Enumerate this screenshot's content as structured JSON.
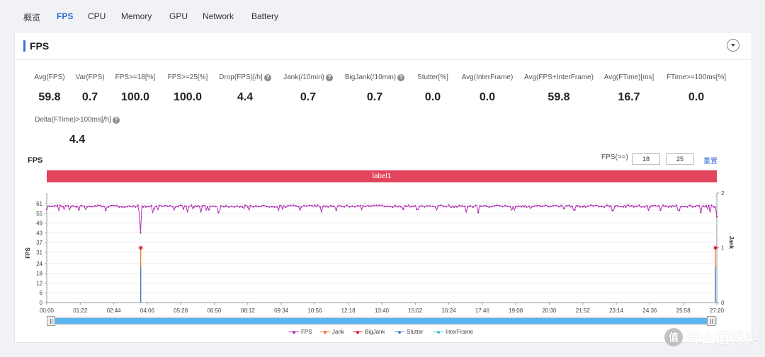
{
  "tabs": [
    {
      "label": "概览",
      "active": false
    },
    {
      "label": "FPS",
      "active": true
    },
    {
      "label": "CPU",
      "active": false
    },
    {
      "label": "Memory",
      "active": false
    },
    {
      "label": "GPU",
      "active": false
    },
    {
      "label": "Network",
      "active": false
    },
    {
      "label": "Battery",
      "active": false
    }
  ],
  "card": {
    "title": "FPS",
    "collapse_icon": "chevron-down-circle-icon"
  },
  "metrics": [
    {
      "label": "Avg(FPS)",
      "value": "59.8",
      "help": false
    },
    {
      "label": "Var(FPS)",
      "value": "0.7",
      "help": false
    },
    {
      "label": "FPS>=18[%]",
      "value": "100.0",
      "help": false
    },
    {
      "label": "FPS>=25[%]",
      "value": "100.0",
      "help": false
    },
    {
      "label": "Drop(FPS)[/h]",
      "value": "4.4",
      "help": true
    },
    {
      "label": "Jank(/10min)",
      "value": "0.7",
      "help": true
    },
    {
      "label": "BigJank(/10min)",
      "value": "0.7",
      "help": true
    },
    {
      "label": "Stutter[%]",
      "value": "0.0",
      "help": false
    },
    {
      "label": "Avg(InterFrame)",
      "value": "0.0",
      "help": false
    },
    {
      "label": "Avg(FPS+InterFrame)",
      "value": "59.8",
      "help": false
    },
    {
      "label": "Avg(FTime)[ms]",
      "value": "16.7",
      "help": false
    },
    {
      "label": "FTime>=100ms[%]",
      "value": "0.0",
      "help": false
    },
    {
      "label": "Delta(FTime)>100ms[/h]",
      "value": "4.4",
      "help": true
    }
  ],
  "help_glyph": "?",
  "chart_header": {
    "title": "FPS",
    "threshold_label": "FPS(>=)",
    "threshold_1": "18",
    "threshold_2": "25",
    "reset_label": "重置"
  },
  "chart_data": {
    "type": "line",
    "title": "FPS",
    "band_label": "label1",
    "xlabel": "",
    "ylabel": "FPS",
    "y2label": "Jank",
    "ylim": [
      0,
      61
    ],
    "y2lim": [
      0,
      2
    ],
    "y_ticks": [
      0,
      6,
      12,
      18,
      24,
      31,
      37,
      43,
      49,
      55,
      61
    ],
    "y2_ticks": [
      0,
      1,
      2
    ],
    "x_ticks": [
      "00:00",
      "01:22",
      "02:44",
      "04:06",
      "05:28",
      "06:50",
      "08:12",
      "09:34",
      "10:56",
      "12:18",
      "13:40",
      "15:02",
      "16:24",
      "17:46",
      "19:08",
      "20:30",
      "21:52",
      "23:14",
      "24:36",
      "25:58",
      "27:20"
    ],
    "x_range_seconds": [
      0,
      1640
    ],
    "grid": true,
    "legend_position": "bottom",
    "series": [
      {
        "name": "FPS",
        "color": "#b02fb4",
        "axis": "left",
        "baseline": 60,
        "description": "steady ~59-60 FPS with small dips to ~56-58; one drop to ~43 at ~03:50 and a drop to ~53 at 27:20"
      },
      {
        "name": "Jank",
        "color": "#f26b2b",
        "axis": "right",
        "points": [
          {
            "t": "03:50",
            "value": 1
          },
          {
            "t": "27:20",
            "value": 1
          }
        ]
      },
      {
        "name": "BigJank",
        "color": "#d9142a",
        "axis": "right",
        "points": [
          {
            "t": "03:50",
            "value": 1
          },
          {
            "t": "27:20",
            "value": 1
          }
        ]
      },
      {
        "name": "Stutter",
        "color": "#4a7fc1",
        "axis": "left",
        "points": [
          {
            "t": "03:50",
            "value": 22
          },
          {
            "t": "27:20",
            "value": 22
          }
        ]
      },
      {
        "name": "InterFrame",
        "color": "#3ec6c9",
        "axis": "left",
        "points": []
      }
    ]
  },
  "slider": {
    "start": 0,
    "end": 1
  },
  "watermark": {
    "logo": "值",
    "text": "什么值得买"
  }
}
